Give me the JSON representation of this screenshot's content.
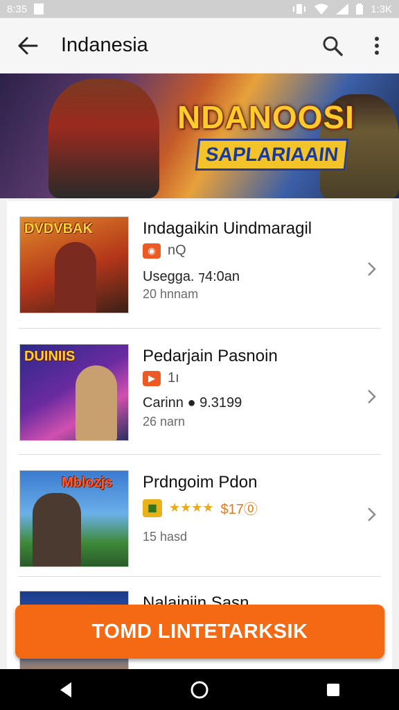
{
  "status_bar": {
    "time": "8:35",
    "clock": "1:3K"
  },
  "app_bar": {
    "title": "Indanesia"
  },
  "banner": {
    "headline": "NDANOOSI",
    "subline": "SAPLARIAAIN"
  },
  "items": [
    {
      "name": "Indagaikin Uindmaragil",
      "badge_text": "nQ",
      "price": "Usegga. ⁊4:0an",
      "sub": "20 hnnam",
      "thumb_title": "DVDVBAK"
    },
    {
      "name": "Pedarjain Pasnoin",
      "badge_text": "1ı",
      "price": "Carinn ● 9.3199",
      "sub": "26 narn",
      "thumb_title": "DUINIIS"
    },
    {
      "name": "Prdngoim Pdon",
      "stars": "★★★★",
      "price": "$17⓪",
      "sub": "15 hasd",
      "thumb_title": "Mblozjs"
    },
    {
      "name": "Nalainiin Sasn"
    }
  ],
  "cta": {
    "label": "TOMD LINTETARKSIK"
  },
  "colors": {
    "accent": "#f46a14",
    "badge": "#ee5a24",
    "star": "#e9a91a"
  },
  "icons": [
    "back-arrow-icon",
    "search-icon",
    "more-vert-icon",
    "chevron-right-icon",
    "nav-back-icon",
    "nav-home-icon",
    "nav-recents-icon"
  ]
}
